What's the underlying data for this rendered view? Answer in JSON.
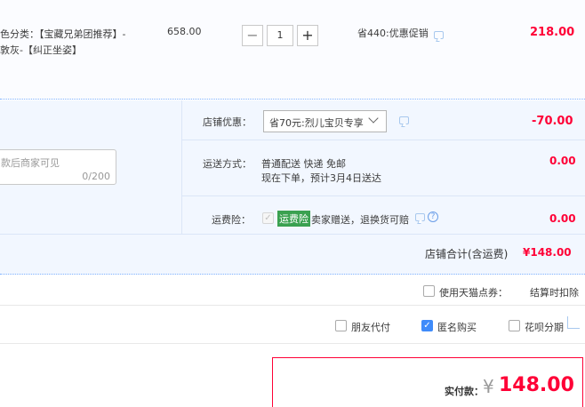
{
  "item": {
    "sku_line1": "色分类：【宝藏兄弟团推荐】-",
    "sku_line2": "敦灰-【纠正坐姿】",
    "unit_price": "658.00",
    "quantity": "1",
    "minus": "−",
    "plus": "+",
    "promo": "省440:优惠促销",
    "subtotal": "218.00"
  },
  "shop": {
    "discount_label": "店铺优惠：",
    "discount_select_value": "省70元:烈儿宝贝专享",
    "discount_amount": "-70.00",
    "message_placeholder": "款后商家可见",
    "message_counter": "0/200",
    "shipping_label": "运送方式：",
    "shipping_method": "普通配送 快递 免邮",
    "shipping_eta": "现在下单，预计3月4日送达",
    "shipping_amount": "0.00",
    "insurance_label": "运费险：",
    "insurance_badge": "运费险",
    "insurance_text": "卖家赠送，退换货可赔",
    "insurance_amount": "0.00",
    "total_label": "店铺合计(含运费)",
    "total_value": "¥148.00"
  },
  "options": {
    "tmall_points_label": "使用天猫点券：",
    "tmall_points_note": "结算时扣除",
    "friend_pay_label": "朋友代付",
    "anonymous_label": "匿名购买",
    "huabei_label": "花呗分期"
  },
  "payment": {
    "label": "实付款：",
    "currency": "¥",
    "amount": "148.00"
  },
  "colors": {
    "accent_red": "#ff0036",
    "section_blue": "#f2f7ff",
    "check_blue": "#3f8bfa",
    "badge_green": "#3aa150"
  }
}
